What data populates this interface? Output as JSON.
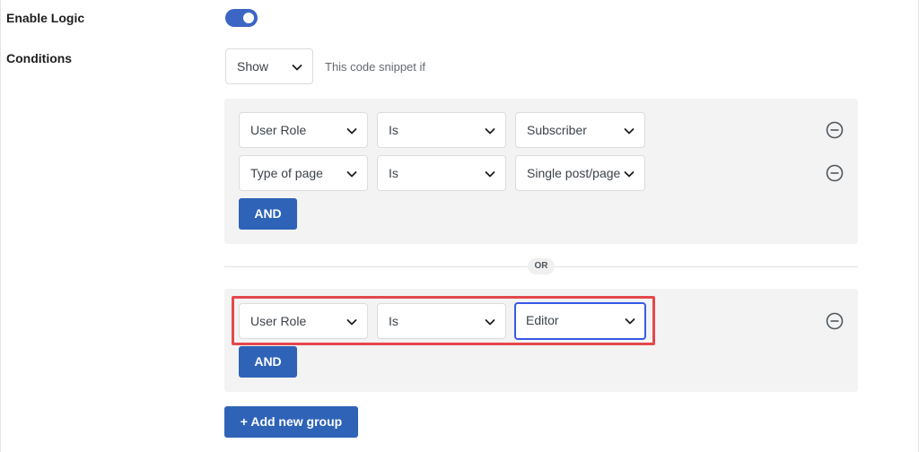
{
  "enable_logic": {
    "label": "Enable Logic",
    "state": "on"
  },
  "conditions": {
    "label": "Conditions",
    "visibility_select": "Show",
    "hint": "This code snippet if"
  },
  "groups": [
    {
      "rules": [
        {
          "field": "User Role",
          "operator": "Is",
          "value": "Subscriber"
        },
        {
          "field": "Type of page",
          "operator": "Is",
          "value": "Single post/page"
        }
      ],
      "and_label": "AND"
    },
    {
      "rules": [
        {
          "field": "User Role",
          "operator": "Is",
          "value": "Editor"
        }
      ],
      "and_label": "AND"
    }
  ],
  "or_label": "OR",
  "add_group_label": "+ Add new group",
  "colors": {
    "accent": "#2e63b8",
    "toggle": "#3b66c4",
    "highlight": "#e4484c",
    "focus": "#3858e9",
    "group_bg": "#f3f3f3"
  }
}
